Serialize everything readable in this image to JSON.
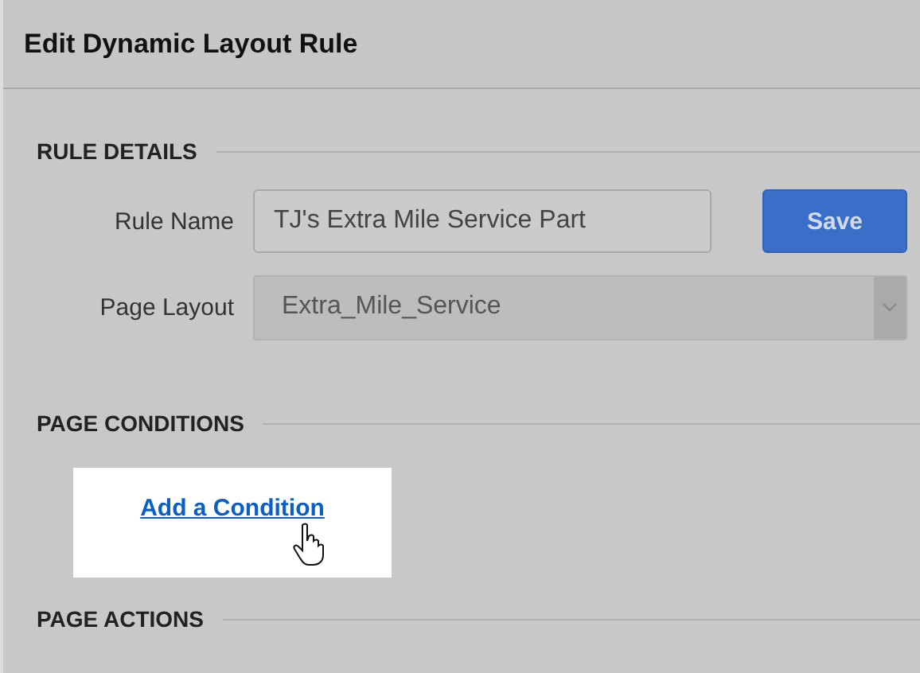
{
  "window": {
    "title": "Edit Dynamic Layout Rule"
  },
  "sections": [
    {
      "kind": "fields",
      "title": "RULE DETAILS",
      "fields": [
        {
          "kind": "text",
          "label": "Rule Name",
          "value": "TJ's Extra Mile Service Part",
          "button": "Save"
        },
        {
          "kind": "select",
          "label": "Page Layout",
          "value": "Extra_Mile_Service",
          "disabled": true
        }
      ]
    },
    {
      "kind": "link",
      "title": "PAGE CONDITIONS",
      "link": "Add a Condition"
    },
    {
      "kind": "empty",
      "title": "PAGE ACTIONS"
    }
  ]
}
